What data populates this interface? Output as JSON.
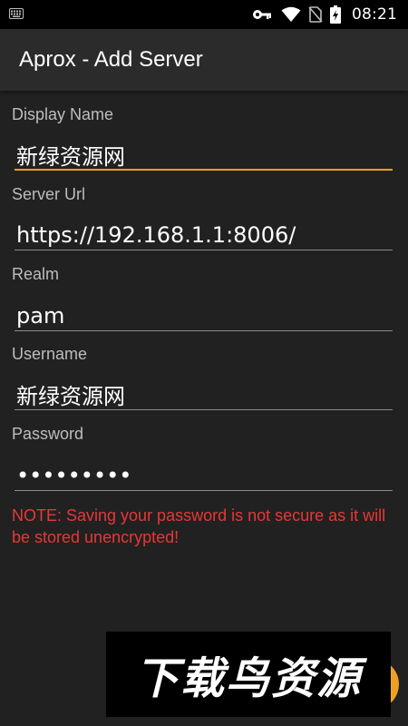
{
  "status_bar": {
    "time": "08:21",
    "icons": [
      "keyboard-icon",
      "key-icon",
      "wifi-icon",
      "no-sim-icon",
      "battery-charging-icon"
    ]
  },
  "app_bar": {
    "title": "Aprox - Add Server"
  },
  "form": {
    "display_name": {
      "label": "Display Name",
      "value": "新绿资源网"
    },
    "server_url": {
      "label": "Server Url",
      "value": "https://192.168.1.1:8006/"
    },
    "realm": {
      "label": "Realm",
      "value": "pam"
    },
    "username": {
      "label": "Username",
      "value": "新绿资源网"
    },
    "password": {
      "label": "Password",
      "value": "•••••••••"
    }
  },
  "warning": "NOTE: Saving your password is not secure as it will be stored unencrypted!",
  "watermark": "下载鸟资源",
  "colors": {
    "accent": "#f0a020",
    "warning": "#e53935",
    "background": "#212121",
    "app_bar": "#2b2b2b"
  }
}
